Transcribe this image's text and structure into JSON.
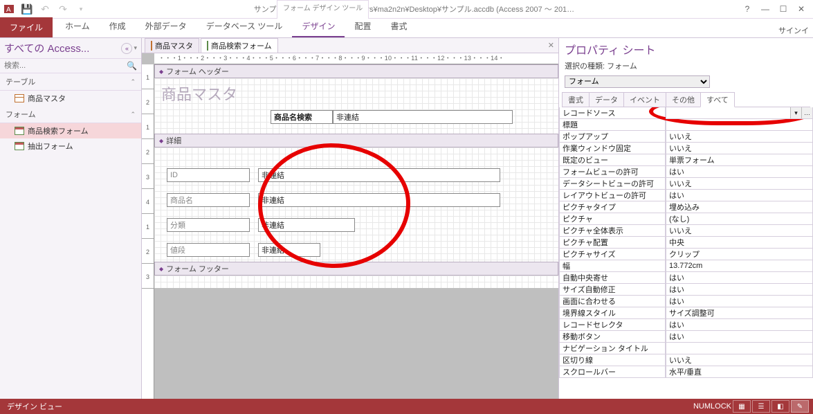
{
  "title": "サンプル：データベース- C:¥Users¥ma2n2n¥Desktop¥サンプル.accdb (Access 2007 ～ 201…",
  "form_tools": "フォーム デザイン ツール",
  "ribbon": {
    "file": "ファイル",
    "tabs": [
      "ホーム",
      "作成",
      "外部データ",
      "データベース ツール",
      "デザイン",
      "配置",
      "書式"
    ],
    "active": 4
  },
  "signin": "サインイ",
  "nav": {
    "head": "すべての Access...",
    "search_ph": "検索...",
    "groups": [
      {
        "label": "テーブル",
        "items": [
          {
            "label": "商品マスタ",
            "kind": "table"
          }
        ]
      },
      {
        "label": "フォーム",
        "items": [
          {
            "label": "商品検索フォーム",
            "kind": "form",
            "sel": true
          },
          {
            "label": "抽出フォーム",
            "kind": "form"
          }
        ]
      }
    ]
  },
  "dtabs": [
    {
      "label": "商品マスタ",
      "kind": "table"
    },
    {
      "label": "商品検索フォーム",
      "kind": "form",
      "active": true
    }
  ],
  "ruler_h": "・・・1・・・2・・・3・・・4・・・5・・・6・・・7・・・8・・・9・・・10・・・11・・・12・・・13・・・14・",
  "sections": {
    "header": "フォーム ヘッダー",
    "detail": "詳細",
    "footer": "フォーム フッター"
  },
  "header_ctls": {
    "title": "商品マスタ",
    "search_lbl": "商品名検索",
    "search_val": "非連結"
  },
  "detail_ctls": [
    {
      "lbl": "ID",
      "val": "非連結"
    },
    {
      "lbl": "商品名",
      "val": "非連結"
    },
    {
      "lbl": "分類",
      "val": "非連結"
    },
    {
      "lbl": "値段",
      "val": "非連結"
    }
  ],
  "props": {
    "title": "プロパティ シート",
    "sub": "選択の種類: フォーム",
    "selector": "フォーム",
    "tabs": [
      "書式",
      "データ",
      "イベント",
      "その他",
      "すべて"
    ],
    "active_tab": 4,
    "rows": [
      {
        "k": "レコードソース",
        "v": "",
        "btns": true
      },
      {
        "k": "標題",
        "v": ""
      },
      {
        "k": "ポップアップ",
        "v": "いいえ"
      },
      {
        "k": "作業ウィンドウ固定",
        "v": "いいえ"
      },
      {
        "k": "既定のビュー",
        "v": "単票フォーム"
      },
      {
        "k": "フォームビューの許可",
        "v": "はい"
      },
      {
        "k": "データシートビューの許可",
        "v": "いいえ"
      },
      {
        "k": "レイアウトビューの許可",
        "v": "はい"
      },
      {
        "k": "ピクチャタイプ",
        "v": "埋め込み"
      },
      {
        "k": "ピクチャ",
        "v": "(なし)"
      },
      {
        "k": "ピクチャ全体表示",
        "v": "いいえ"
      },
      {
        "k": "ピクチャ配置",
        "v": "中央"
      },
      {
        "k": "ピクチャサイズ",
        "v": "クリップ"
      },
      {
        "k": "幅",
        "v": "13.772cm"
      },
      {
        "k": "自動中央寄せ",
        "v": "はい"
      },
      {
        "k": "サイズ自動修正",
        "v": "はい"
      },
      {
        "k": "画面に合わせる",
        "v": "はい"
      },
      {
        "k": "境界線スタイル",
        "v": "サイズ調整可"
      },
      {
        "k": "レコードセレクタ",
        "v": "はい"
      },
      {
        "k": "移動ボタン",
        "v": "はい"
      },
      {
        "k": "ナビゲーション タイトル",
        "v": ""
      },
      {
        "k": "区切り線",
        "v": "いいえ"
      },
      {
        "k": "スクロールバー",
        "v": "水平/垂直"
      }
    ]
  },
  "status": {
    "left": "デザイン ビュー",
    "numlock": "NUMLOCK"
  }
}
